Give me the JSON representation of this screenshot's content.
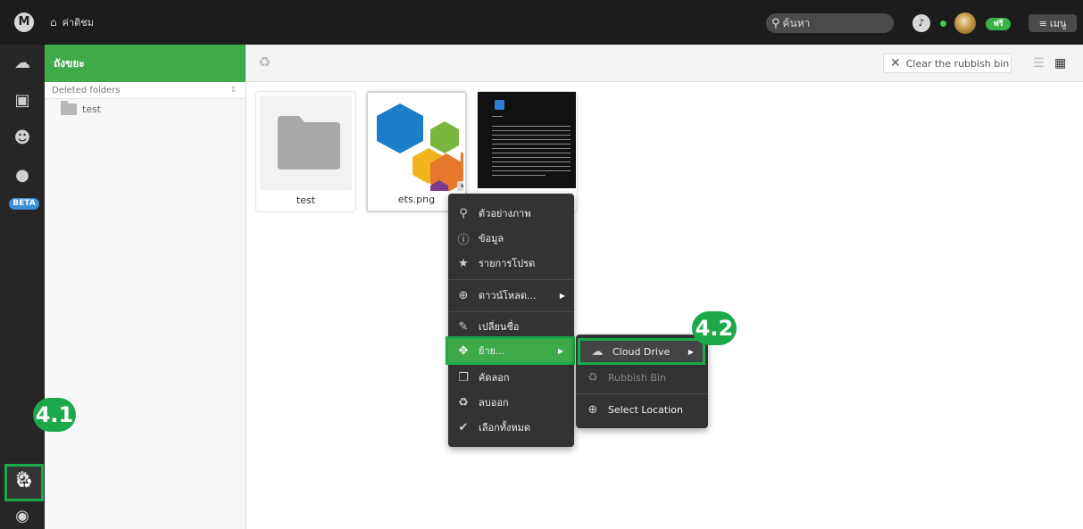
{
  "topbar": {
    "logo": "M",
    "breadcrumb": "ค่าติชม",
    "search_placeholder": "ค้นหา",
    "free_badge": "ฟรี",
    "menu_label": "เมนู"
  },
  "rail": {
    "beta": "BETA"
  },
  "tree": {
    "header": "ถังขยะ",
    "sub_label": "Deleted folders",
    "items": [
      {
        "label": "test"
      }
    ]
  },
  "main": {
    "clear_button": "Clear the rubbish bin",
    "cards": [
      {
        "label": "test"
      },
      {
        "label": "ets.png"
      },
      {
        "label": ""
      }
    ]
  },
  "context_menu": {
    "items": [
      {
        "label": "ตัวอย่างภาพ",
        "icon": "search-icon"
      },
      {
        "label": "ข้อมูล",
        "icon": "info-icon"
      },
      {
        "label": "รายการโปรด",
        "icon": "star-icon"
      },
      {
        "label": "ดาวน์โหลด...",
        "icon": "download-icon"
      },
      {
        "label": "เปลี่ยนชื่อ",
        "icon": "pencil-icon"
      },
      {
        "label": "ย้าย...",
        "icon": "move-icon"
      },
      {
        "label": "คัดลอก",
        "icon": "copy-icon"
      },
      {
        "label": "ลบออก",
        "icon": "recycle-icon"
      },
      {
        "label": "เลือกทั้งหมด",
        "icon": "check-icon"
      }
    ]
  },
  "submenu": {
    "items": [
      {
        "label": "Cloud Drive",
        "icon": "cloud-icon"
      },
      {
        "label": "Rubbish Bin",
        "icon": "recycle-icon"
      },
      {
        "label": "Select Location",
        "icon": "target-icon"
      }
    ]
  },
  "callouts": {
    "step1": "4.1",
    "step2": "4.2"
  },
  "colors": {
    "accent_green": "#3faa48",
    "callout_green": "#1da84a",
    "beta_blue": "#3c8fd6"
  }
}
